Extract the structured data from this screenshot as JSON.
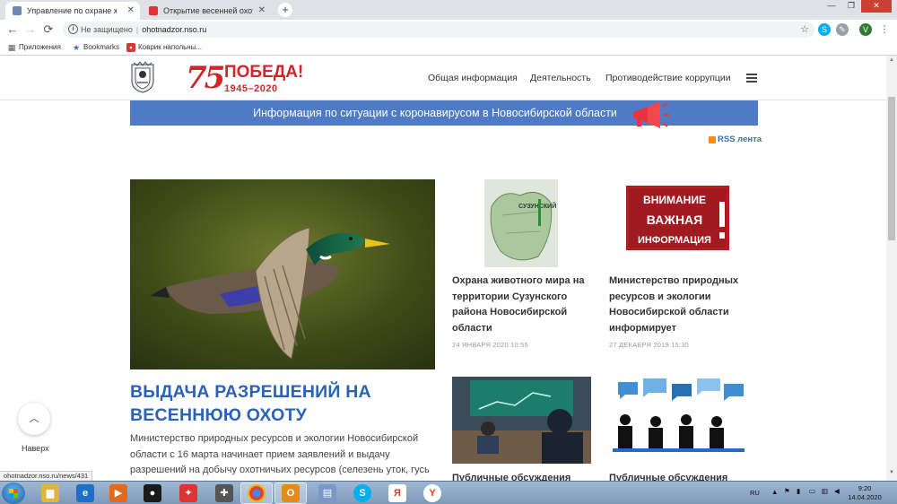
{
  "browser": {
    "tabs": [
      {
        "title": "Управление по охране животно",
        "active": true
      },
      {
        "title": "Открытие весенней охоты в НС",
        "active": false
      }
    ],
    "new_tab": "+",
    "window_buttons": [
      "—",
      "❐",
      "✕"
    ],
    "omnibox": {
      "security_label": "Не защищено",
      "url": "ohotnadzor.nso.ru"
    },
    "profile_initial": "V",
    "bookmarks": [
      {
        "label": "Приложения",
        "icon": "apps-grid-icon"
      },
      {
        "label": "Bookmarks",
        "icon": "star-icon"
      },
      {
        "label": "Коврик напольны...",
        "icon": "page-icon"
      }
    ],
    "status_url": "ohotnadzor.nso.ru/news/431"
  },
  "site": {
    "promo": {
      "number": "75",
      "word": "ПОБЕДА!",
      "years": "1945–2020"
    },
    "nav": [
      {
        "label": "Общая информация"
      },
      {
        "label": "Деятельность"
      },
      {
        "label": "Противодействие коррупции"
      }
    ],
    "covid_banner": "Информация по ситуации с коронавирусом в Новосибирской области",
    "rss_label": "RSS лента",
    "hero": {
      "title": "ВЫДАЧА РАЗРЕШЕНИЙ НА ВЕСЕННЮЮ ОХОТУ",
      "text": "Министерство природных ресурсов и экологии Новосибирской области с 16 марта начинает прием заявлений и выдачу разрешений на добычу охотничьих ресурсов (селезень уток, гусь белолобый, гусь гуменник, гусь серый, вальдшнеп, тетерев, глухарь) на"
    },
    "cards": [
      {
        "title": "Охрана животного мира на территории Сузунского района Новосибирской области",
        "date": "24 ЯНВАРЯ 2020 10:55",
        "image_text": "СУЗУНСКИЙ РАЙОН"
      },
      {
        "title": "Министерство природных ресурсов и экологии Новосибирской области информирует",
        "date": "27 ДЕКАБРЯ 2019 15:30",
        "image_text": [
          "ВНИМАНИЕ",
          "ВАЖНАЯ",
          "ИНФОРМАЦИЯ"
        ]
      },
      {
        "title": "Публичные обсуждения"
      },
      {
        "title": "Публичные обсуждения"
      }
    ],
    "back_to_top": "Наверх"
  },
  "taskbar": {
    "language": "RU",
    "time": "9:20",
    "date": "14.04.2020"
  },
  "colors": {
    "accent_blue": "#2a62b8",
    "banner_blue": "#4f7bc4",
    "promo_red": "#d0252b"
  }
}
